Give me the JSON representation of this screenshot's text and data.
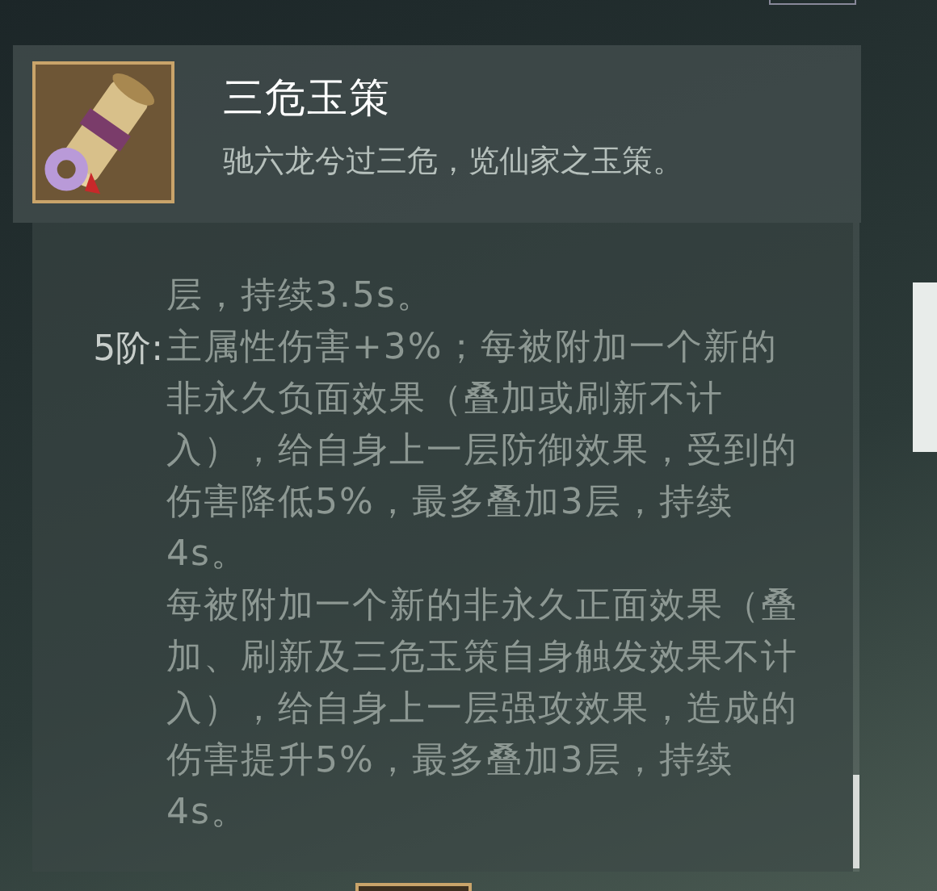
{
  "item": {
    "name": "三危玉策",
    "flavor": "驰六龙兮过三危，览仙家之玉策。"
  },
  "tiers": [
    {
      "paragraphs": [
        "层，持续3.5s。"
      ]
    },
    {
      "label": "5阶:",
      "paragraphs": [
        "主属性伤害+3%；每被附加一个新的非永久负面效果（叠加或刷新不计入），给自身上一层防御效果，受到的伤害降低5%，最多叠加3层，持续4s。",
        "每被附加一个新的非永久正面效果（叠加、刷新及三危玉策自身触发效果不计入），给自身上一层强攻效果，造成的伤害提升5%，最多叠加3层，持续4s。"
      ]
    }
  ]
}
